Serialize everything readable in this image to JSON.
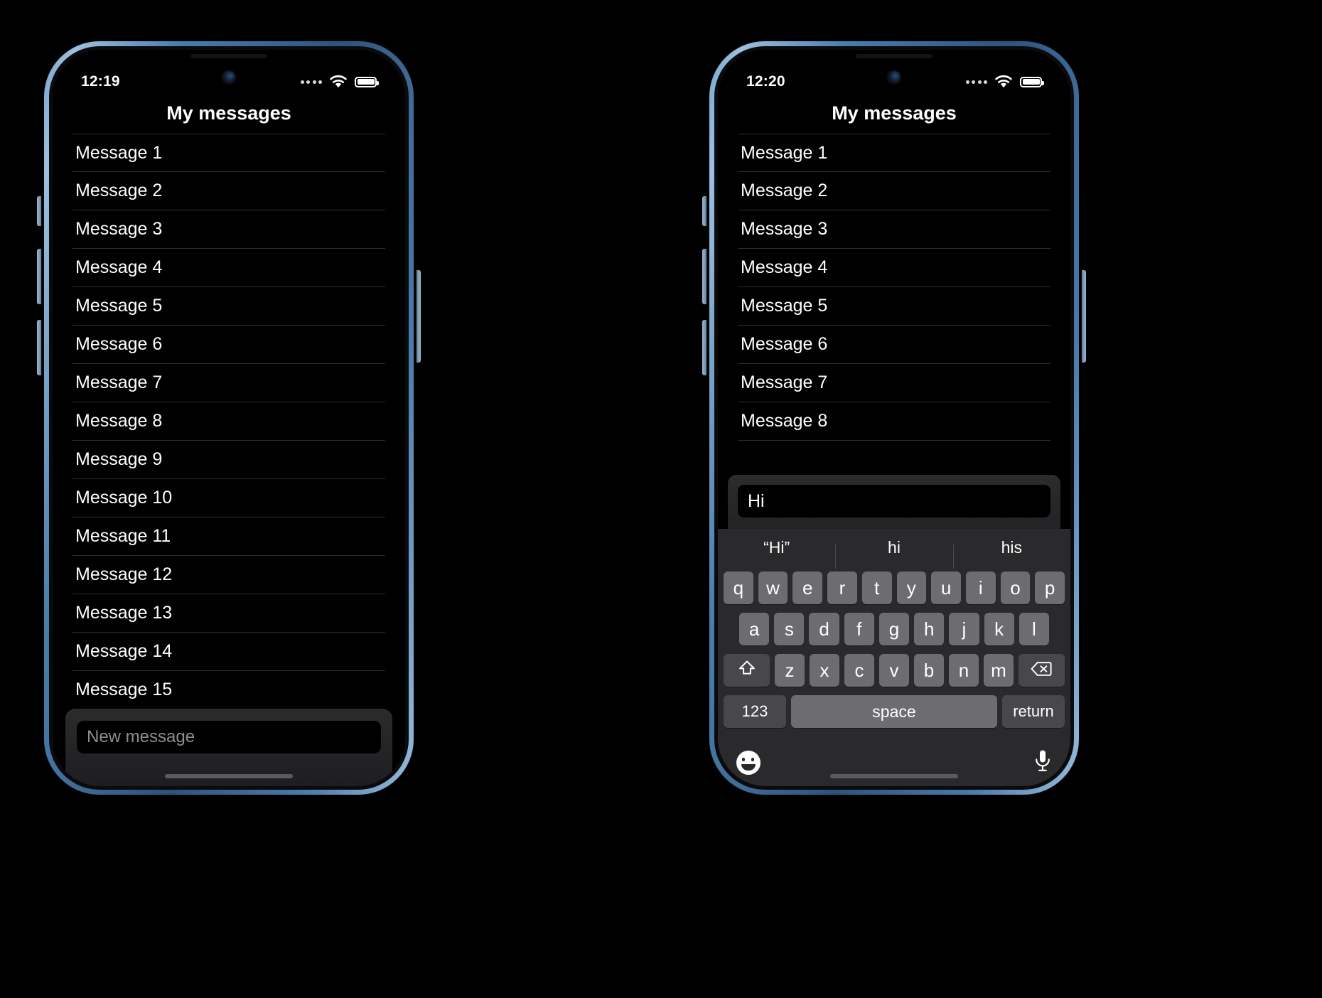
{
  "phones": [
    {
      "id": "left",
      "status": {
        "time": "12:19",
        "cellular_icon": "cellular-dots-icon",
        "wifi_icon": "wifi-icon",
        "battery_icon": "battery-full-icon"
      },
      "nav": {
        "title": "My messages"
      },
      "messages": [
        "Message 1",
        "Message 2",
        "Message 3",
        "Message 4",
        "Message 5",
        "Message 6",
        "Message 7",
        "Message 8",
        "Message 9",
        "Message 10",
        "Message 11",
        "Message 12",
        "Message 13",
        "Message 14",
        "Message 15"
      ],
      "composer": {
        "value": "",
        "placeholder": "New message"
      },
      "keyboard_visible": false
    },
    {
      "id": "right",
      "status": {
        "time": "12:20",
        "cellular_icon": "cellular-dots-icon",
        "wifi_icon": "wifi-icon",
        "battery_icon": "battery-full-icon"
      },
      "nav": {
        "title": "My messages"
      },
      "messages": [
        "Message 1",
        "Message 2",
        "Message 3",
        "Message 4",
        "Message 5",
        "Message 6",
        "Message 7",
        "Message 8"
      ],
      "composer": {
        "value": "Hi",
        "placeholder": "New message"
      },
      "keyboard_visible": true
    }
  ],
  "keyboard": {
    "suggestions": [
      "“Hi”",
      "hi",
      "his"
    ],
    "row1": [
      "q",
      "w",
      "e",
      "r",
      "t",
      "y",
      "u",
      "i",
      "o",
      "p"
    ],
    "row2": [
      "a",
      "s",
      "d",
      "f",
      "g",
      "h",
      "j",
      "k",
      "l"
    ],
    "row3_letters": [
      "z",
      "x",
      "c",
      "v",
      "b",
      "n",
      "m"
    ],
    "shift_icon": "shift-arrow-icon",
    "backspace_icon": "backspace-icon",
    "numbers_label": "123",
    "space_label": "space",
    "return_label": "return",
    "emoji_icon": "emoji-smiley-icon",
    "dictation_icon": "microphone-icon"
  },
  "colors": {
    "frame": "#4b7cac",
    "screen_bg": "#000000",
    "key_light": "#6d6d71",
    "key_dark": "#48484c",
    "keyboard_bg": "#2a2a2c",
    "separator": "#2e2e30",
    "placeholder_text": "#8d8d92",
    "text": "#ffffff"
  }
}
